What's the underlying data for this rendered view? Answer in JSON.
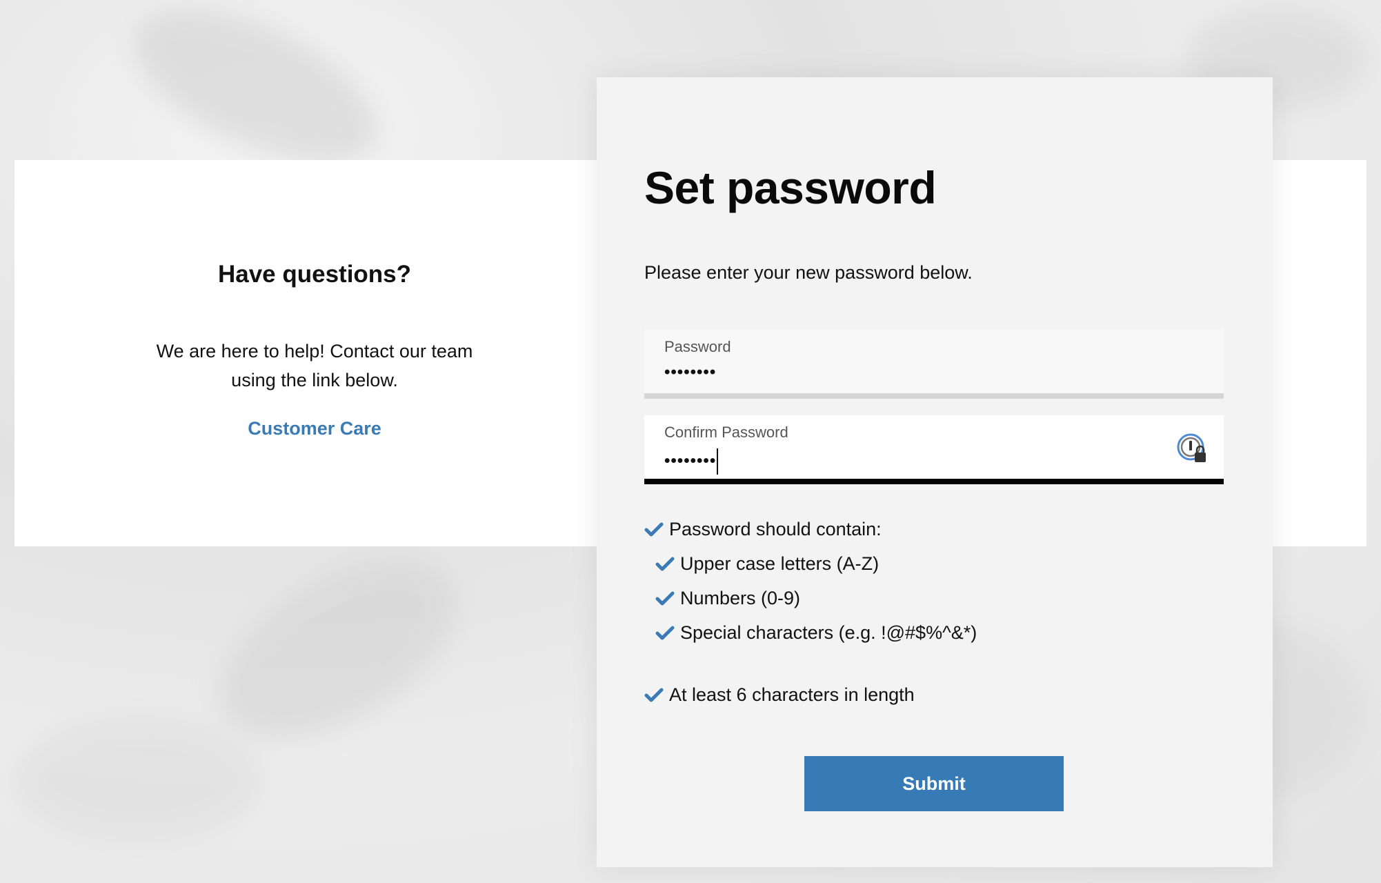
{
  "help": {
    "title": "Have questions?",
    "text": "We are here to help! Contact our team using the link below.",
    "link_label": "Customer Care"
  },
  "form": {
    "title": "Set password",
    "subtitle": "Please enter your new password below.",
    "password": {
      "label": "Password",
      "value": "••••••••"
    },
    "confirm_password": {
      "label": "Confirm Password",
      "value": "••••••••"
    },
    "requirements": {
      "heading": "Password should contain:",
      "items": [
        "Upper case letters (A-Z)",
        "Numbers (0-9)",
        "Special characters (e.g. !@#$%^&*)"
      ],
      "length": "At least 6 characters in length"
    },
    "submit_label": "Submit"
  },
  "colors": {
    "accent": "#367bb6",
    "link": "#3a7ab5",
    "check": "#3a7ab5"
  },
  "icons": {
    "password_manager": "password-manager-icon",
    "check": "checkmark-icon"
  }
}
